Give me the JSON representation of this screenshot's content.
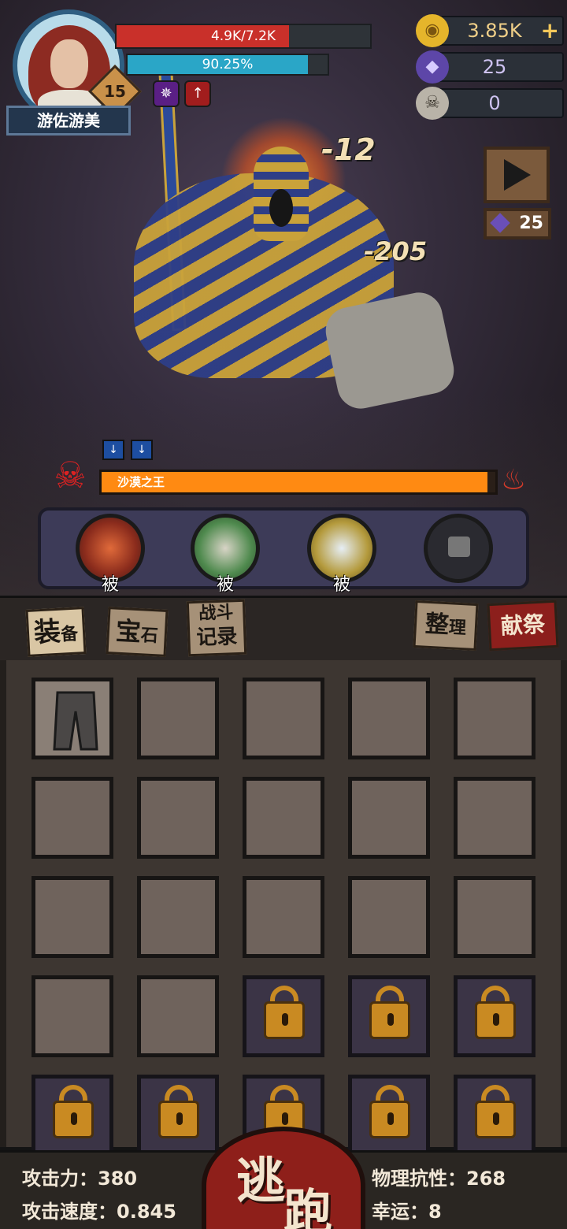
{
  "player": {
    "name": "游佐游美",
    "level": "15",
    "hp_text": "4.9K/7.2K",
    "hp_fraction": 0.68,
    "mp_text": "90.25%",
    "mp_fraction": 0.9025,
    "buffs": [
      "vortex-icon",
      "shield-up-icon"
    ]
  },
  "currencies": [
    {
      "icon": "gold-coin-icon",
      "value": "3.85K"
    },
    {
      "icon": "purple-crystal-icon",
      "value": "25"
    },
    {
      "icon": "ram-skull-icon",
      "value": "0"
    }
  ],
  "ad_reward": {
    "cost": "25"
  },
  "damage_numbers": [
    "-12",
    "-205"
  ],
  "boss": {
    "name": "沙漠之王",
    "hp_fraction": 0.98,
    "debuffs": [
      "shield-down-icon",
      "shield-down-icon"
    ]
  },
  "skills": [
    {
      "icon": "claw-slash-icon",
      "tag": "被"
    },
    {
      "icon": "fist-icon",
      "tag": "被"
    },
    {
      "icon": "blade-icon",
      "tag": "被"
    },
    {
      "icon": "lock-icon",
      "tag": ""
    }
  ],
  "tabs": {
    "equip": [
      "装",
      "备"
    ],
    "gem": [
      "宝",
      "石"
    ],
    "log": [
      "战斗",
      "记录"
    ],
    "sort": [
      "整",
      "理"
    ],
    "sacrifice": "献祭"
  },
  "inventory": {
    "rows": [
      [
        "pants",
        "empty",
        "empty",
        "empty",
        "empty"
      ],
      [
        "empty",
        "empty",
        "empty",
        "empty",
        "empty"
      ],
      [
        "empty",
        "empty",
        "empty",
        "empty",
        "empty"
      ],
      [
        "empty",
        "empty",
        "locked",
        "locked",
        "locked"
      ],
      [
        "locked",
        "locked",
        "locked",
        "locked",
        "locked"
      ]
    ]
  },
  "stats": {
    "attack": "攻击力：380",
    "attack_speed": "攻击速度：0.845",
    "phys_resist": "物理抗性：268",
    "luck": "幸运：8"
  },
  "flee": [
    "逃",
    "跑"
  ]
}
